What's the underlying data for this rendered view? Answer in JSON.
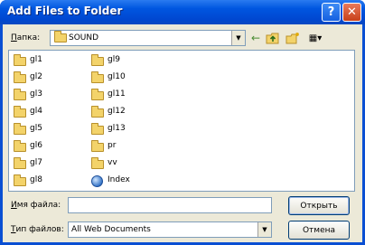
{
  "window": {
    "title": "Add Files to Folder",
    "help_glyph": "?",
    "close_glyph": "✕"
  },
  "lookin": {
    "label_first": "П",
    "label_rest": "апка:",
    "value": "SOUND",
    "arrow": "▼"
  },
  "toolbar": {
    "back_glyph": "←",
    "views_glyph": "▦▾"
  },
  "files": [
    {
      "name": "gl1",
      "type": "folder"
    },
    {
      "name": "gl2",
      "type": "folder"
    },
    {
      "name": "gl3",
      "type": "folder"
    },
    {
      "name": "gl4",
      "type": "folder"
    },
    {
      "name": "gl5",
      "type": "folder"
    },
    {
      "name": "gl6",
      "type": "folder"
    },
    {
      "name": "gl7",
      "type": "folder"
    },
    {
      "name": "gl8",
      "type": "folder"
    },
    {
      "name": "gl9",
      "type": "folder"
    },
    {
      "name": "gl10",
      "type": "folder"
    },
    {
      "name": "gl11",
      "type": "folder"
    },
    {
      "name": "gl12",
      "type": "folder"
    },
    {
      "name": "gl13",
      "type": "folder"
    },
    {
      "name": "pr",
      "type": "folder"
    },
    {
      "name": "vv",
      "type": "folder"
    },
    {
      "name": "Index",
      "type": "web-document"
    }
  ],
  "filename": {
    "label_first": "И",
    "label_rest": "мя файла:",
    "value": ""
  },
  "filetype": {
    "label_first": "Т",
    "label_rest": "ип файлов:",
    "value": "All Web Documents",
    "arrow": "▼"
  },
  "buttons": {
    "open_label": "Открыть",
    "cancel_label": "Отмена"
  }
}
